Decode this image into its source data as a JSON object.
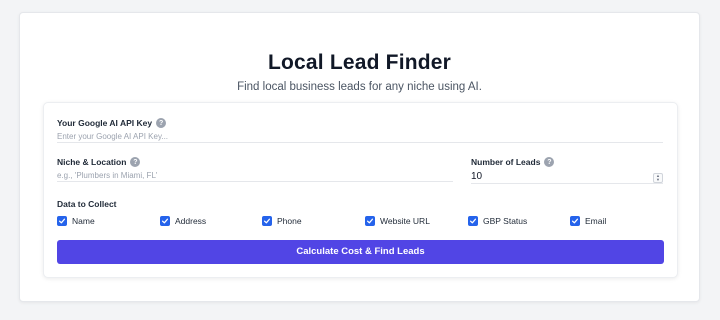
{
  "header": {
    "title": "Local Lead Finder",
    "subtitle": "Find local business leads for any niche using AI."
  },
  "form": {
    "api_key": {
      "label": "Your Google AI API Key",
      "placeholder": "Enter your Google AI API Key...",
      "value": ""
    },
    "niche": {
      "label": "Niche & Location",
      "placeholder": "e.g., 'Plumbers in Miami, FL'",
      "value": ""
    },
    "num_leads": {
      "label": "Number of Leads",
      "value": "10"
    },
    "collect": {
      "label": "Data to Collect",
      "options": [
        {
          "label": "Name",
          "checked": true
        },
        {
          "label": "Address",
          "checked": true
        },
        {
          "label": "Phone",
          "checked": true
        },
        {
          "label": "Website URL",
          "checked": true
        },
        {
          "label": "GBP Status",
          "checked": true
        },
        {
          "label": "Email",
          "checked": true
        }
      ]
    },
    "submit_label": "Calculate Cost & Find Leads",
    "help_glyph": "?"
  },
  "colors": {
    "accent": "#5145e5",
    "checkbox": "#2563eb"
  }
}
